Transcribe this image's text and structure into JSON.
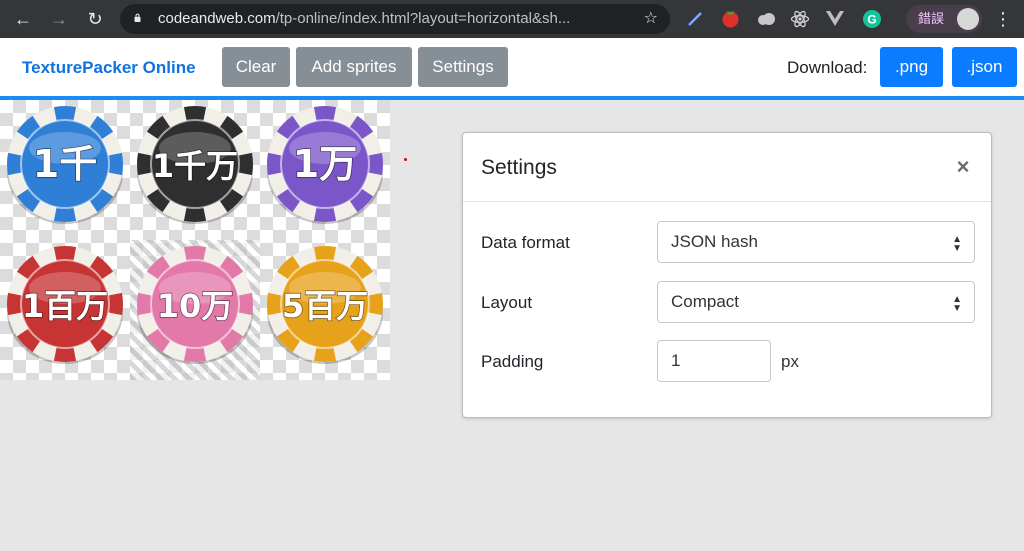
{
  "browser": {
    "url_host": "codeandweb.com",
    "url_path": "/tp-online/index.html?layout=horizontal&sh...",
    "profile_label": "錯誤"
  },
  "app": {
    "brand": "TexturePacker Online",
    "buttons": {
      "clear": "Clear",
      "add_sprites": "Add sprites",
      "settings": "Settings"
    },
    "download_label": "Download:",
    "download_png": ".png",
    "download_json": ".json"
  },
  "sprites": [
    {
      "label": "1千",
      "color": "#2f7fd6"
    },
    {
      "label": "1千万",
      "color": "#2f2f2f"
    },
    {
      "label": "1万",
      "color": "#7a56c9"
    },
    {
      "label": "1百万",
      "color": "#c73434"
    },
    {
      "label": "10万",
      "color": "#e379a9"
    },
    {
      "label": "5百万",
      "color": "#e7a21b"
    }
  ],
  "settings_dialog": {
    "title": "Settings",
    "data_format_label": "Data format",
    "data_format_value": "JSON hash",
    "layout_label": "Layout",
    "layout_value": "Compact",
    "padding_label": "Padding",
    "padding_value": "1",
    "padding_unit": "px"
  },
  "colors": {
    "accent": "#0a7cff",
    "brand_text": "#0e73e0",
    "gray_button": "#868e96",
    "toolbar_rule": "#1a8cf5"
  }
}
